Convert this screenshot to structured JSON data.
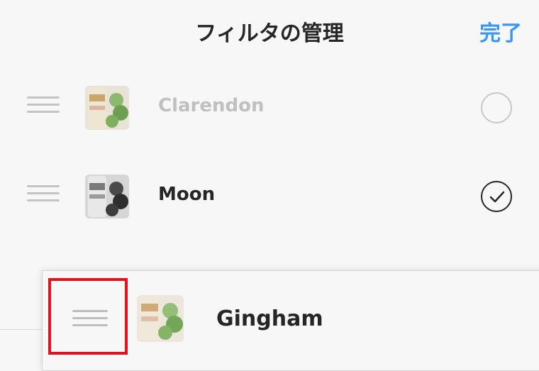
{
  "header": {
    "title": "フィルタの管理",
    "done_label": "完了"
  },
  "filters": [
    {
      "name": "Clarendon",
      "enabled": false,
      "thumbnail": "color-photo"
    },
    {
      "name": "Moon",
      "enabled": true,
      "thumbnail": "grayscale-photo"
    },
    {
      "name": "Gingham",
      "enabled": null,
      "thumbnail": "faded-color-photo",
      "state": "dragging"
    }
  ],
  "colors": {
    "accent": "#3897f0",
    "highlight": "#e0141e",
    "disabled_text": "#c0c0c0"
  }
}
